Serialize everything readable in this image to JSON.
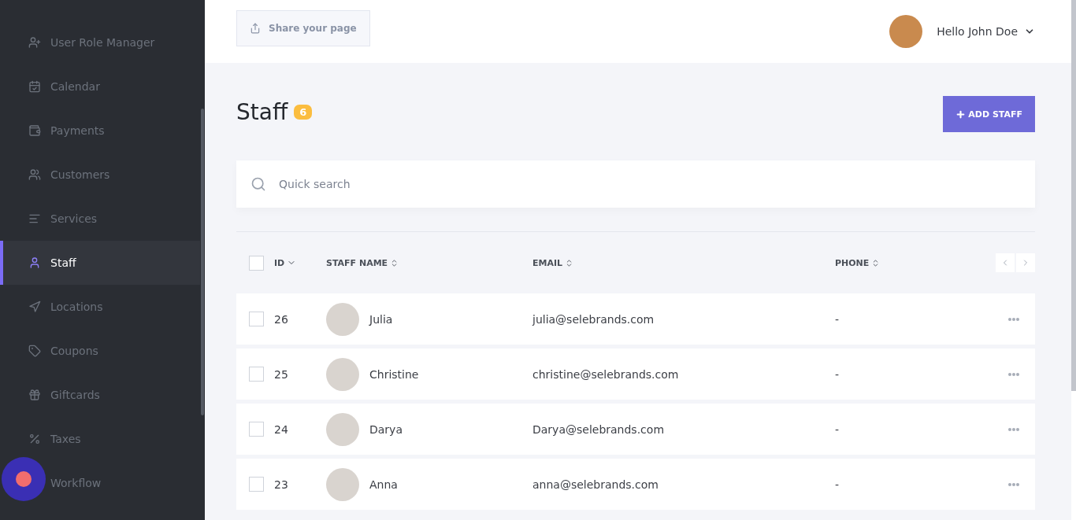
{
  "sidebar": {
    "items": [
      {
        "label": "User Role Manager",
        "selected": false
      },
      {
        "label": "Calendar",
        "selected": false
      },
      {
        "label": "Payments",
        "selected": false
      },
      {
        "label": "Customers",
        "selected": false
      },
      {
        "label": "Services",
        "selected": false
      },
      {
        "label": "Staff",
        "selected": true
      },
      {
        "label": "Locations",
        "selected": false
      },
      {
        "label": "Coupons",
        "selected": false
      },
      {
        "label": "Giftcards",
        "selected": false
      },
      {
        "label": "Taxes",
        "selected": false
      },
      {
        "label": "Workflow",
        "selected": false
      }
    ]
  },
  "header": {
    "share_button": "Share your page",
    "greeting": "Hello John Doe"
  },
  "page": {
    "title": "Staff",
    "count": "6",
    "add_button": "ADD STAFF"
  },
  "search": {
    "placeholder": "Quick search"
  },
  "table": {
    "select_all_checked": false,
    "columns": [
      "ID",
      "STAFF NAME",
      "EMAIL",
      "PHONE"
    ],
    "rows": [
      {
        "id": "26",
        "name": "Julia",
        "email": "julia@selebrands.com",
        "phone": "-",
        "checked": false
      },
      {
        "id": "25",
        "name": "Christine",
        "email": "christine@selebrands.com",
        "phone": "-",
        "checked": false
      },
      {
        "id": "24",
        "name": "Darya",
        "email": "Darya@selebrands.com",
        "phone": "-",
        "checked": false
      },
      {
        "id": "23",
        "name": "Anna",
        "email": "anna@selebrands.com",
        "phone": "-",
        "checked": false
      }
    ]
  }
}
